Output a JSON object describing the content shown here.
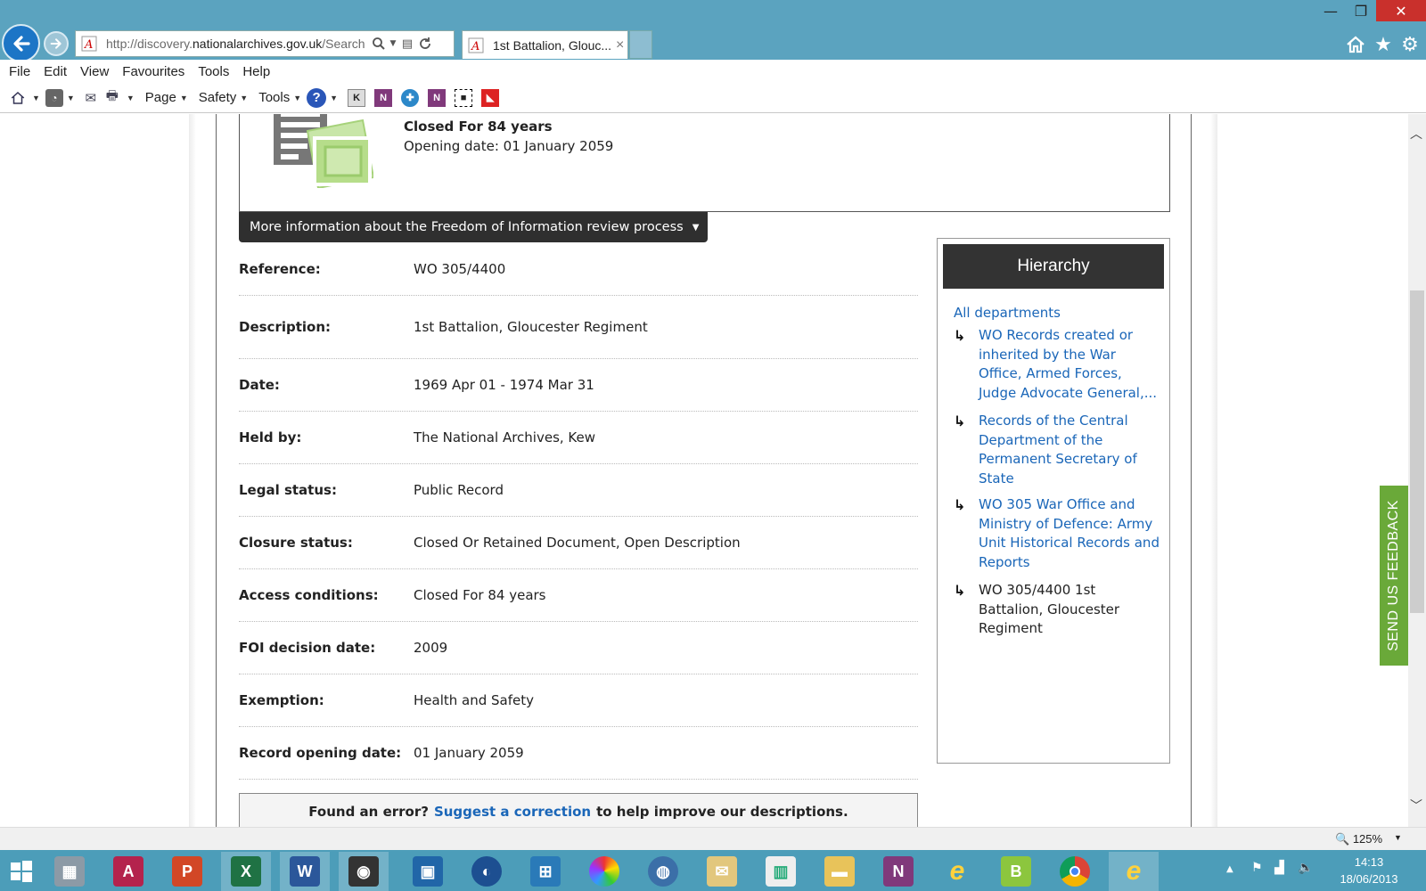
{
  "browser": {
    "url_prefix": "http://discovery.",
    "url_domain": "nationalarchives.gov.uk",
    "url_suffix": "/Search",
    "tab_title": "1st Battalion, Glouc...",
    "tab_close": "×"
  },
  "menu": [
    "File",
    "Edit",
    "View",
    "Favourites",
    "Tools",
    "Help"
  ],
  "toolbar": {
    "page": "Page",
    "safety": "Safety",
    "tools": "Tools"
  },
  "closure": {
    "title": "Closed For 84 years",
    "opening": "Opening date: 01 January 2059"
  },
  "foi_button": "More information about the Freedom of Information review process",
  "details": [
    {
      "label": "Reference:",
      "value": "WO 305/4400"
    },
    {
      "label": "Description:",
      "value": "1st Battalion, Gloucester Regiment"
    },
    {
      "label": "Date:",
      "value": "1969 Apr 01 - 1974 Mar 31"
    },
    {
      "label": "Held by:",
      "value": "The National Archives, Kew"
    },
    {
      "label": "Legal status:",
      "value": "Public Record"
    },
    {
      "label": "Closure status:",
      "value": "Closed Or Retained Document, Open Description"
    },
    {
      "label": "Access conditions:",
      "value": "Closed For 84 years"
    },
    {
      "label": "FOI decision date:",
      "value": "2009"
    },
    {
      "label": "Exemption:",
      "value": "Health and Safety"
    },
    {
      "label": "Record opening date:",
      "value": "01 January 2059"
    }
  ],
  "error_box": {
    "prefix": "Found an error?",
    "link": "Suggest a correction",
    "suffix": "to help improve our descriptions."
  },
  "hierarchy": {
    "title": "Hierarchy",
    "top": "All departments",
    "items": [
      {
        "text": "WO Records created or inherited by the War Office, Armed Forces, Judge Advocate General,..."
      },
      {
        "text": "Records of the Central Department of the Permanent Secretary of State"
      },
      {
        "text": "WO 305 War Office and Ministry of Defence: Army Unit Historical Records and Reports"
      },
      {
        "text": "WO 305/4400 1st Battalion, Gloucester Regiment"
      }
    ]
  },
  "feedback": "SEND US FEEDBACK",
  "status": {
    "zoom": "125%"
  },
  "clock": {
    "time": "14:13",
    "date": "18/06/2013"
  },
  "taskbar_icons": [
    "calculator-icon",
    "access-icon",
    "powerpoint-icon",
    "excel-icon",
    "word-icon",
    "camera-icon",
    "app-icon",
    "google-earth-icon",
    "network-icon",
    "color-wheel-icon",
    "globe-icon",
    "mail-icon",
    "window-icon",
    "folder-icon",
    "onenote-icon",
    "ie-icon",
    "b-icon",
    "chrome-icon",
    "ie-active-icon"
  ],
  "colors": {
    "link": "#1a66b8",
    "titlebar": "#5ba3bf",
    "feedback": "#6aa939",
    "close": "#c9302c"
  }
}
